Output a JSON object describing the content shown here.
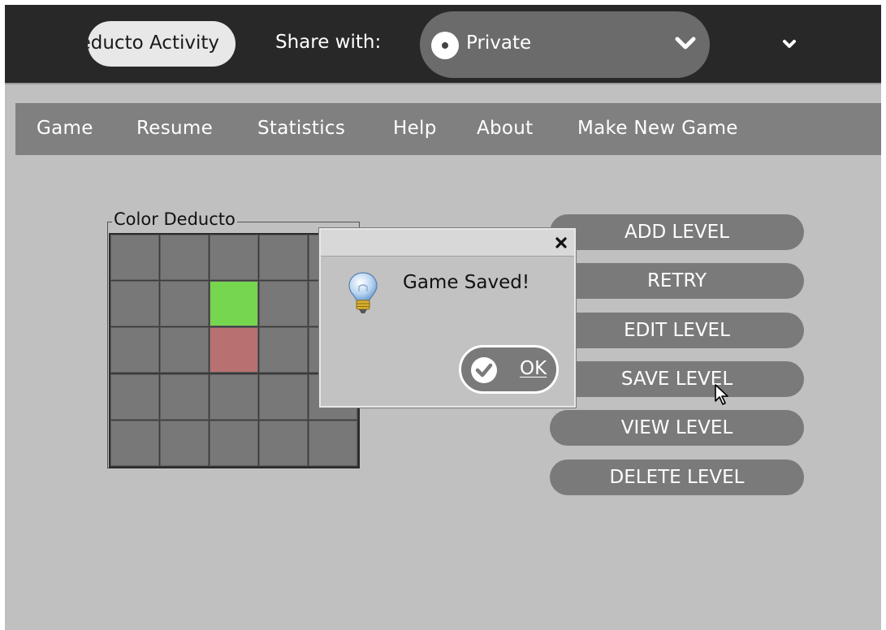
{
  "toolbar": {
    "activity_name": "Deducto Activity",
    "share_label": "Share with:",
    "share_value": "Private",
    "share_icon": "private-radio-icon",
    "share_chevron_icon": "chevron-down-icon",
    "toolbar_chevron_icon": "chevron-down-icon"
  },
  "menu": {
    "items": [
      "Game",
      "Resume",
      "Statistics",
      "Help",
      "About",
      "Make New Game"
    ]
  },
  "board": {
    "title": "Color Deducto",
    "rows": 5,
    "cols": 5,
    "cell_color_default": "#787878",
    "highlighted_cells": [
      {
        "row": 1,
        "col": 2,
        "color": "#77d64f"
      },
      {
        "row": 2,
        "col": 2,
        "color": "#b87070"
      }
    ]
  },
  "level_buttons": [
    "ADD LEVEL",
    "RETRY",
    "EDIT LEVEL",
    "SAVE LEVEL",
    "VIEW LEVEL",
    "DELETE LEVEL"
  ],
  "dialog": {
    "message": "Game Saved!",
    "ok_label": "OK",
    "icon": "lightbulb-icon",
    "close_icon": "close-icon",
    "ok_icon": "checkmark-icon"
  },
  "colors": {
    "toolbar_bg": "#282828",
    "canvas_bg": "#c0c0c0",
    "menubar_bg": "#808080",
    "button_bg": "#7a7a7a"
  }
}
